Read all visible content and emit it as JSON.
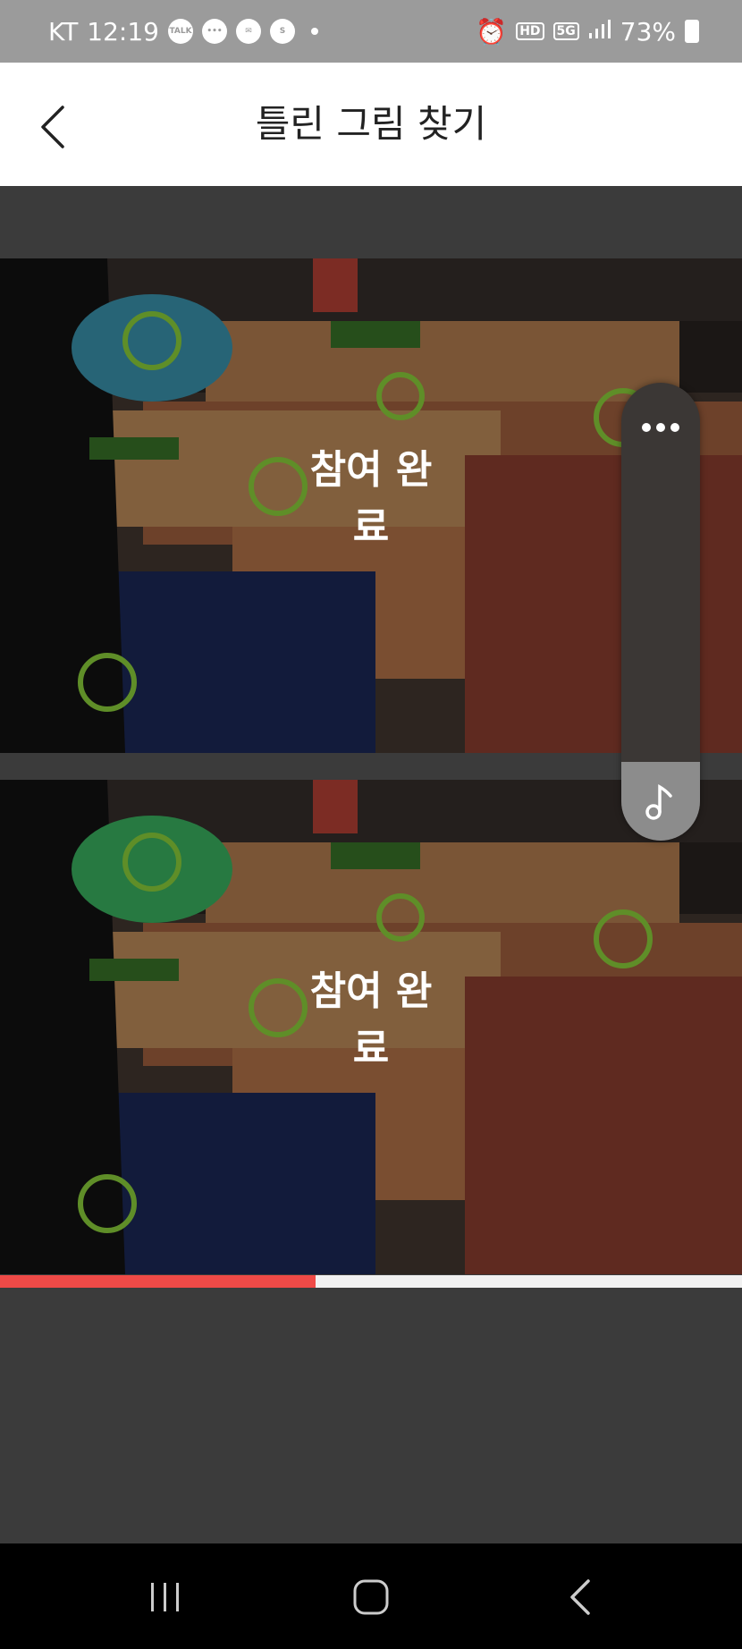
{
  "status_bar": {
    "carrier": "KT",
    "time": "12:19",
    "notif_icons": [
      "talk-icon",
      "chat-icon",
      "message-icon",
      "supersol-icon"
    ],
    "talk_label": "TALK",
    "hd_label": "HD",
    "network_label": "5G",
    "battery": "73%"
  },
  "header": {
    "title": "틀린 그림 찾기"
  },
  "game": {
    "done_label_top": "참여 완료",
    "done_label_bottom": "참여 완료",
    "progress": 0.425,
    "accent_color": "#ef4a47",
    "marker_color": "#5f8e28"
  },
  "nav": {
    "buttons": [
      "recents-icon",
      "home-icon",
      "back-icon"
    ]
  }
}
